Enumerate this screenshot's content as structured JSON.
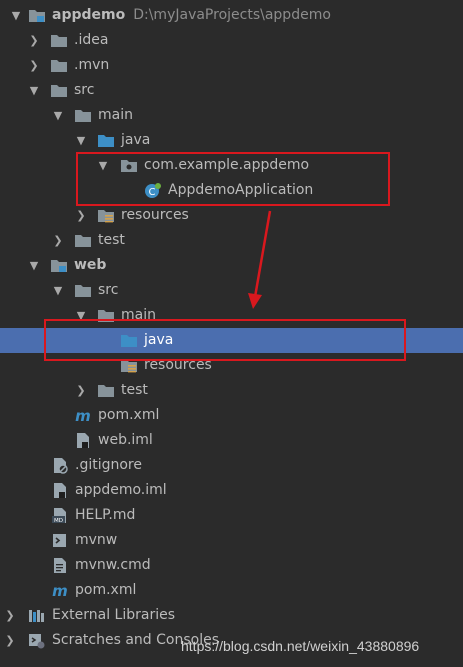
{
  "tree": {
    "root": {
      "name": "appdemo",
      "path": "D:\\myJavaProjects\\appdemo"
    },
    "idea": ".idea",
    "mvn": ".mvn",
    "src": "src",
    "main": "main",
    "java": "java",
    "package": "com.example.appdemo",
    "app_class": "AppdemoApplication",
    "resources": "resources",
    "test": "test",
    "web": {
      "name": "web",
      "src": "src",
      "main": "main",
      "java": "java",
      "resources": "resources",
      "test": "test",
      "pom": "pom.xml",
      "iml": "web.iml"
    },
    "gitignore": ".gitignore",
    "appdemo_iml": "appdemo.iml",
    "help": "HELP.md",
    "mvnw": "mvnw",
    "mvnw_cmd": "mvnw.cmd",
    "pom": "pom.xml",
    "external_libraries": "External Libraries",
    "scratches": "Scratches and Consoles"
  },
  "watermark": "https://blog.csdn.net/weixin_43880896",
  "colors": {
    "background": "#2b2b2b",
    "selection": "#4b6eaf",
    "annotation": "#d9181e",
    "folder": "#87939a",
    "source_folder": "#3d8fc6"
  }
}
